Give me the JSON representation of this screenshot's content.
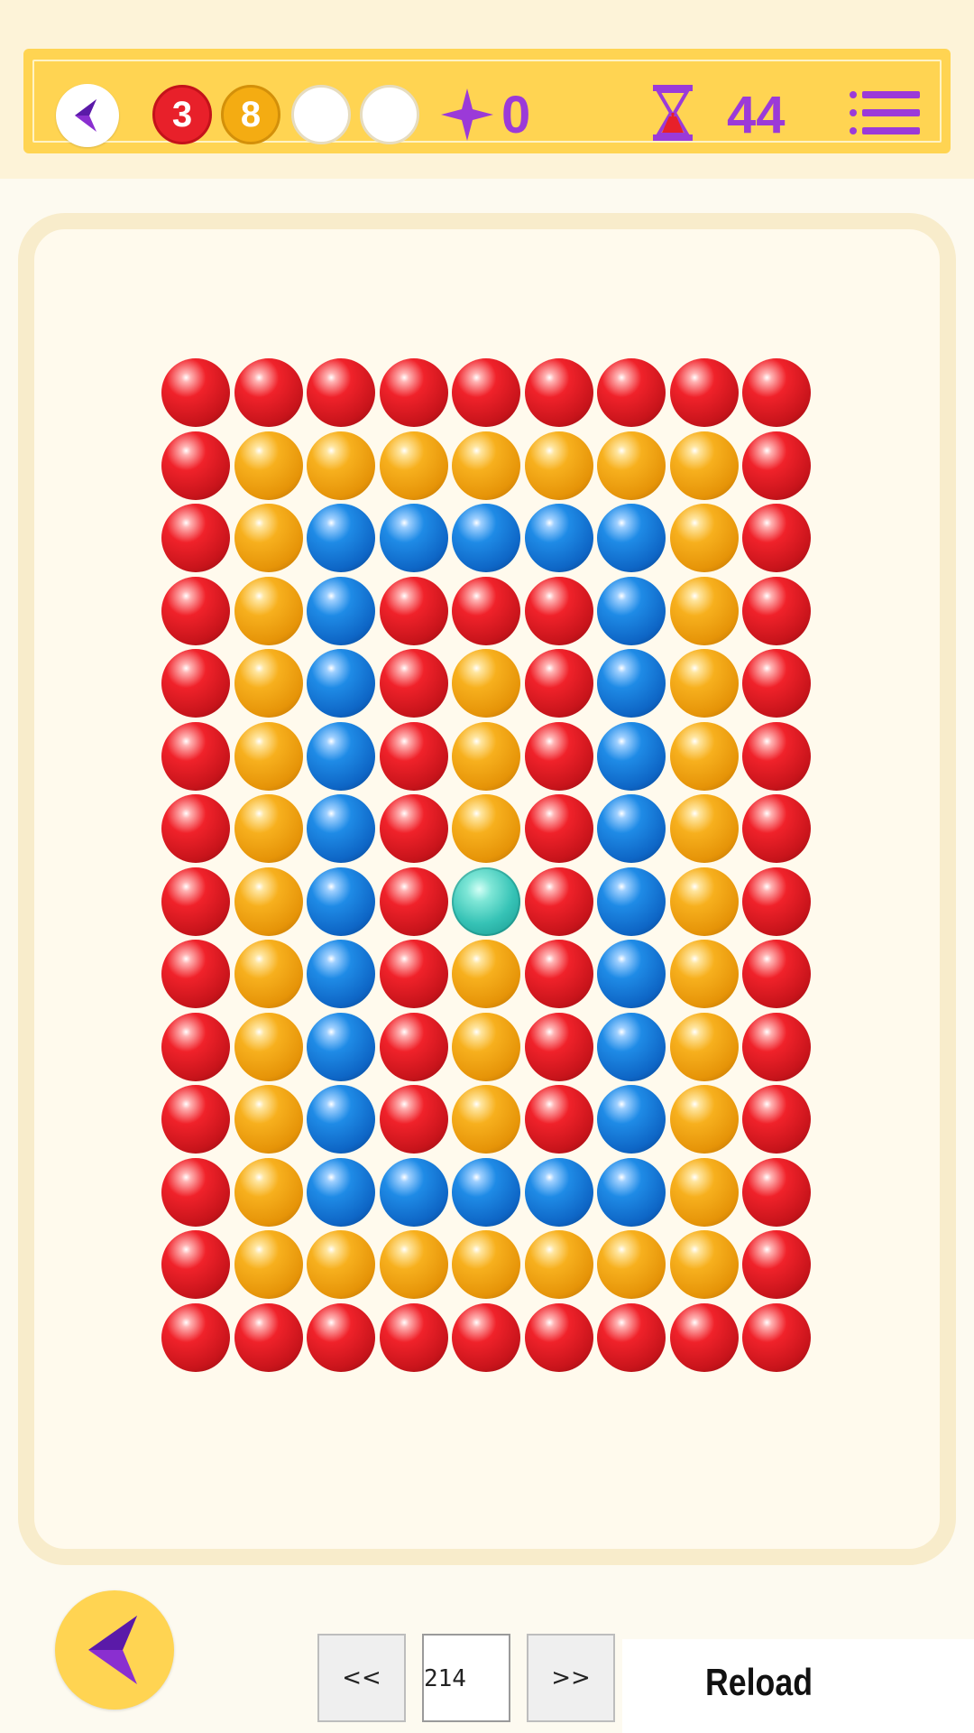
{
  "hud": {
    "counters": [
      "3",
      "8",
      "",
      ""
    ],
    "stars": "0",
    "timer": "44",
    "icons": [
      "back-arrow-icon",
      "star-icon",
      "hourglass-icon",
      "menu-list-icon"
    ]
  },
  "colors": {
    "hud_bg": "#ffd452",
    "accent_purple": "#9b3ad8",
    "red": "#e8202a",
    "orange": "#f4ac12",
    "blue": "#1f8be6",
    "teal": "#36c3b6"
  },
  "board": {
    "rows": [
      [
        "red",
        "red",
        "red",
        "red",
        "red",
        "red",
        "red",
        "red",
        "red"
      ],
      [
        "red",
        "orange",
        "orange",
        "orange",
        "orange",
        "orange",
        "orange",
        "orange",
        "red"
      ],
      [
        "red",
        "orange",
        "blue",
        "blue",
        "blue",
        "blue",
        "blue",
        "orange",
        "red"
      ],
      [
        "red",
        "orange",
        "blue",
        "red",
        "red",
        "red",
        "blue",
        "orange",
        "red"
      ],
      [
        "red",
        "orange",
        "blue",
        "red",
        "orange",
        "red",
        "blue",
        "orange",
        "red"
      ],
      [
        "red",
        "orange",
        "blue",
        "red",
        "orange",
        "red",
        "blue",
        "orange",
        "red"
      ],
      [
        "red",
        "orange",
        "blue",
        "red",
        "orange",
        "red",
        "blue",
        "orange",
        "red"
      ],
      [
        "red",
        "orange",
        "blue",
        "red",
        "teal",
        "red",
        "blue",
        "orange",
        "red"
      ],
      [
        "red",
        "orange",
        "blue",
        "red",
        "orange",
        "red",
        "blue",
        "orange",
        "red"
      ],
      [
        "red",
        "orange",
        "blue",
        "red",
        "orange",
        "red",
        "blue",
        "orange",
        "red"
      ],
      [
        "red",
        "orange",
        "blue",
        "red",
        "orange",
        "red",
        "blue",
        "orange",
        "red"
      ],
      [
        "red",
        "orange",
        "blue",
        "blue",
        "blue",
        "blue",
        "blue",
        "orange",
        "red"
      ],
      [
        "red",
        "orange",
        "orange",
        "orange",
        "orange",
        "orange",
        "orange",
        "orange",
        "red"
      ],
      [
        "red",
        "red",
        "red",
        "red",
        "red",
        "red",
        "red",
        "red",
        "red"
      ]
    ]
  },
  "controls": {
    "prev_label": "<<",
    "next_label": ">>",
    "level_value": "214",
    "reload_label": "Reload"
  }
}
